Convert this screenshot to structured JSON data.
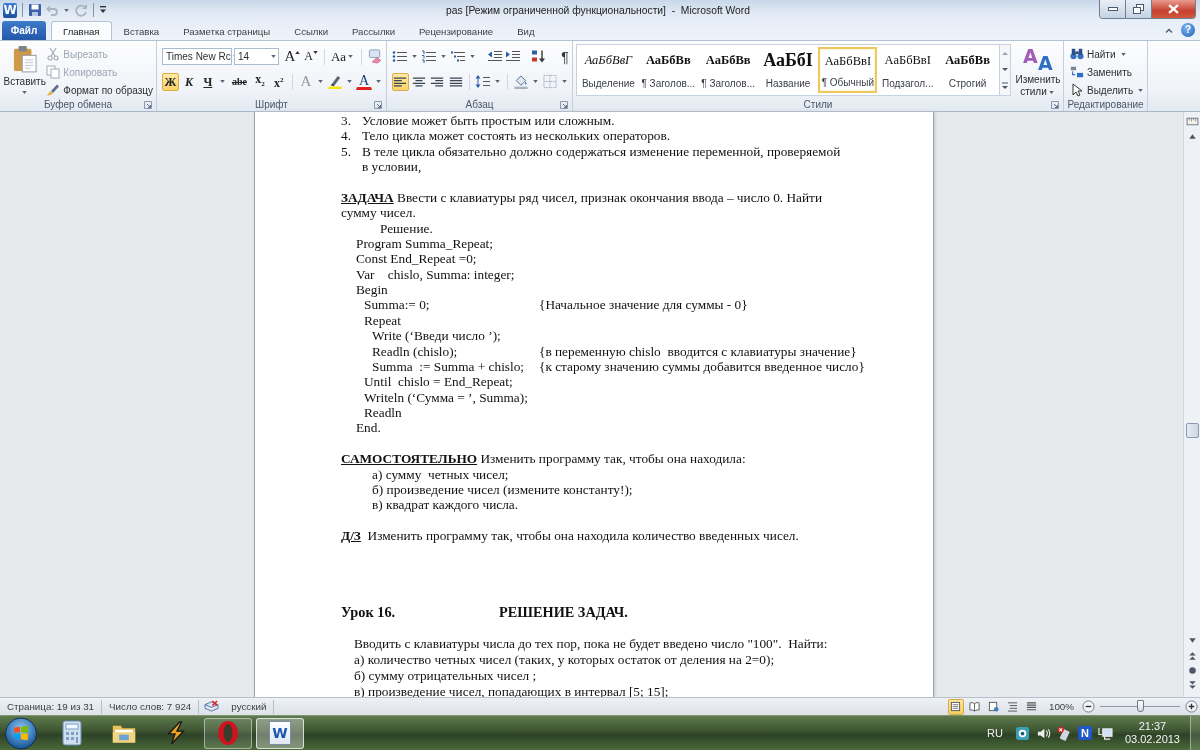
{
  "window": {
    "app_logo": "W",
    "title": "pas [Режим ограниченной функциональности]  -  Microsoft Word"
  },
  "quick_access": [
    {
      "kind": "save",
      "disabled": false
    },
    {
      "kind": "undo",
      "disabled": true
    },
    {
      "kind": "redo",
      "disabled": true
    }
  ],
  "file_tab": "Файл",
  "tabs": [
    {
      "label": "Главная",
      "selected": true
    },
    {
      "label": "Вставка",
      "selected": false
    },
    {
      "label": "Разметка страницы",
      "selected": false
    },
    {
      "label": "Ссылки",
      "selected": false
    },
    {
      "label": "Рассылки",
      "selected": false
    },
    {
      "label": "Рецензирование",
      "selected": false
    },
    {
      "label": "Вид",
      "selected": false
    }
  ],
  "help": "?",
  "clipboard": {
    "title": "Буфер обмена",
    "paste": "Вставить",
    "actions": [
      {
        "kind": "cut",
        "label": "Вырезать",
        "disabled": true
      },
      {
        "kind": "copy",
        "label": "Копировать",
        "disabled": true
      },
      {
        "kind": "format-painter",
        "label": "Формат по образцу",
        "disabled": false
      }
    ]
  },
  "font": {
    "title": "Шрифт",
    "font_name": "Times New Rc",
    "font_size": "14",
    "size_buttons": [
      {
        "kind": "grow",
        "label": "A"
      },
      {
        "kind": "shrink",
        "label": "A"
      }
    ],
    "change_case": "Aa",
    "format_buttons": [
      {
        "kind": "bold",
        "label": "Ж",
        "selected": true
      },
      {
        "kind": "italic",
        "label": "К",
        "selected": false
      },
      {
        "kind": "underline",
        "label": "Ч",
        "selected": false
      },
      {
        "kind": "strikethrough",
        "label": "abe",
        "selected": false
      },
      {
        "kind": "subscript",
        "label": "x$_{2}$",
        "selected": false
      },
      {
        "kind": "superscript",
        "label": "x$^{2}$",
        "selected": false
      }
    ],
    "effects": {
      "label": "A",
      "disabled": true
    },
    "font_color": {
      "label": "A"
    }
  },
  "paragraph": {
    "title": "Абзац",
    "show_marks": {
      "label": "¶",
      "selected": false
    },
    "alignment": [
      {
        "kind": "left",
        "selected": true
      },
      {
        "kind": "center",
        "selected": false
      },
      {
        "kind": "right",
        "selected": false
      },
      {
        "kind": "justify",
        "selected": false
      }
    ]
  },
  "styles": {
    "title": "Стили",
    "items": [
      {
        "kind": "emphasis",
        "sample": "АаБбВвГ",
        "name": "Выделение",
        "selected": false
      },
      {
        "kind": "heading",
        "sample": "АаБбВв",
        "name": "¶ Заголов...",
        "selected": false
      },
      {
        "kind": "heading",
        "sample": "АаБбВв",
        "name": "¶ Заголов...",
        "selected": false
      },
      {
        "kind": "title",
        "sample": "АаБбI",
        "name": "Название",
        "selected": false
      },
      {
        "kind": "normal",
        "sample": "АаБбВвI",
        "name": "¶ Обычный",
        "selected": true
      },
      {
        "kind": "subtitle",
        "sample": "АаБбВвI",
        "name": "Подзагол...",
        "selected": false
      },
      {
        "kind": "strong",
        "sample": "АаБбВв",
        "name": "Строгий",
        "selected": false
      }
    ],
    "change_styles": {
      "icon_letters": [
        "A",
        "A"
      ],
      "label": "Изменить стили"
    }
  },
  "editing": {
    "title": "Редактирование",
    "items": [
      {
        "kind": "find",
        "label": "Найти",
        "dropdown": true
      },
      {
        "kind": "replace",
        "label": "Заменить",
        "dropdown": false
      },
      {
        "kind": "select",
        "label": "Выделить",
        "dropdown": true
      }
    ]
  },
  "document": {
    "paragraphs": [
      {
        "kind": "numbered",
        "number": "3.",
        "text": "Условие может быть простым или сложным."
      },
      {
        "kind": "numbered",
        "number": "4.",
        "text": "Тело цикла может состоять из нескольких операторов."
      },
      {
        "kind": "numbered",
        "number": "5.",
        "text": "В теле цикла обязательно должно содержаться изменение переменной, проверяемой в условии,"
      },
      {
        "kind": "blank"
      },
      {
        "kind": "body",
        "text": "**ЗАДАЧА** Ввести с клавиатуры ряд чисел, признак окончания ввода – число 0. Найти сумму чисел."
      },
      {
        "kind": "caption",
        "text": "Решение."
      },
      {
        "kind": "code",
        "lines": [
          {
            "text": "Program Summa_Repeat;"
          },
          {
            "text": "Const End_Repeat =0;"
          },
          {
            "text": "Var    chislo, Summa: integer;"
          },
          {
            "text": "Begin",
            "children": [
              {
                "text": "Summa:= 0;",
                "comment": "{Начальное значение для суммы - 0}"
              },
              {
                "text": "Repeat",
                "children": [
                  {
                    "text": "Write (‘Введи число ’);"
                  },
                  {
                    "text": "Readln (chislo);",
                    "comment": "{в переменную chislo  вводится с клавиатуры значение}"
                  },
                  {
                    "text": "Summa  := Summa + chislo;",
                    "comment": "{к старому значению суммы добавится введенное число}"
                  }
                ]
              },
              {
                "text": "Until  chislo = End_Repeat;"
              },
              {
                "text": "Writeln (‘Сумма = ’, Summa);"
              },
              {
                "text": "Readln"
              }
            ]
          },
          {
            "text": "End."
          }
        ]
      },
      {
        "kind": "blank"
      },
      {
        "kind": "body",
        "text": "**САМОСТОЯТЕЛЬНО** Изменить программу так, чтобы она находила:"
      },
      {
        "kind": "subitem",
        "text": "а) сумму  четных чисел;"
      },
      {
        "kind": "subitem",
        "text": "б) произведение чисел (измените константу!);"
      },
      {
        "kind": "subitem",
        "text": "в) квадрат каждого числа."
      },
      {
        "kind": "blank"
      },
      {
        "kind": "body",
        "text": "**Д/З**  Изменить программу так, чтобы она находила количество введенных чисел."
      },
      {
        "kind": "blank"
      },
      {
        "kind": "blank"
      },
      {
        "kind": "blank"
      },
      {
        "kind": "blank"
      },
      {
        "kind": "lesson_title",
        "number": "Урок 16.",
        "title": "РЕШЕНИЕ ЗАДАЧ."
      },
      {
        "kind": "blank"
      },
      {
        "kind": "lesson",
        "text": "Вводить с клавиатуры числа до тех пор, пока не будет введено число \"100\".  Найти:"
      },
      {
        "kind": "lesson",
        "text": "а) количество четных чисел (таких, у которых остаток от деления на 2=0);"
      },
      {
        "kind": "lesson",
        "text": "б) сумму отрицательных чисел ;"
      },
      {
        "kind": "lesson",
        "text": "в) произведение чисел, попадающих в интервал [5; 15];"
      }
    ]
  },
  "status_bar": {
    "page": "Страница: 19 из 31",
    "words": "Число слов: 7 924",
    "language": "русский",
    "views": [
      {
        "kind": "print-layout",
        "selected": true
      },
      {
        "kind": "reading",
        "selected": false
      },
      {
        "kind": "web-layout",
        "selected": false
      },
      {
        "kind": "outline",
        "selected": false
      },
      {
        "kind": "draft",
        "selected": false
      }
    ],
    "zoom": "100%",
    "zoom_slider": {
      "level": 0.5
    }
  },
  "taskbar": {
    "apps": [
      {
        "kind": "calculator",
        "running": false,
        "selected": false
      },
      {
        "kind": "explorer",
        "running": false,
        "selected": false
      },
      {
        "kind": "winamp",
        "running": false,
        "selected": false
      },
      {
        "kind": "opera",
        "running": true,
        "selected": false
      },
      {
        "kind": "word",
        "running": true,
        "selected": true,
        "label": "W"
      }
    ],
    "language": "RU",
    "tray": [
      {
        "kind": "app"
      },
      {
        "kind": "volume"
      },
      {
        "kind": "network-error"
      },
      {
        "kind": "letter",
        "label": "N"
      },
      {
        "kind": "network"
      }
    ],
    "time": "21:37",
    "date": "03.02.2013"
  }
}
